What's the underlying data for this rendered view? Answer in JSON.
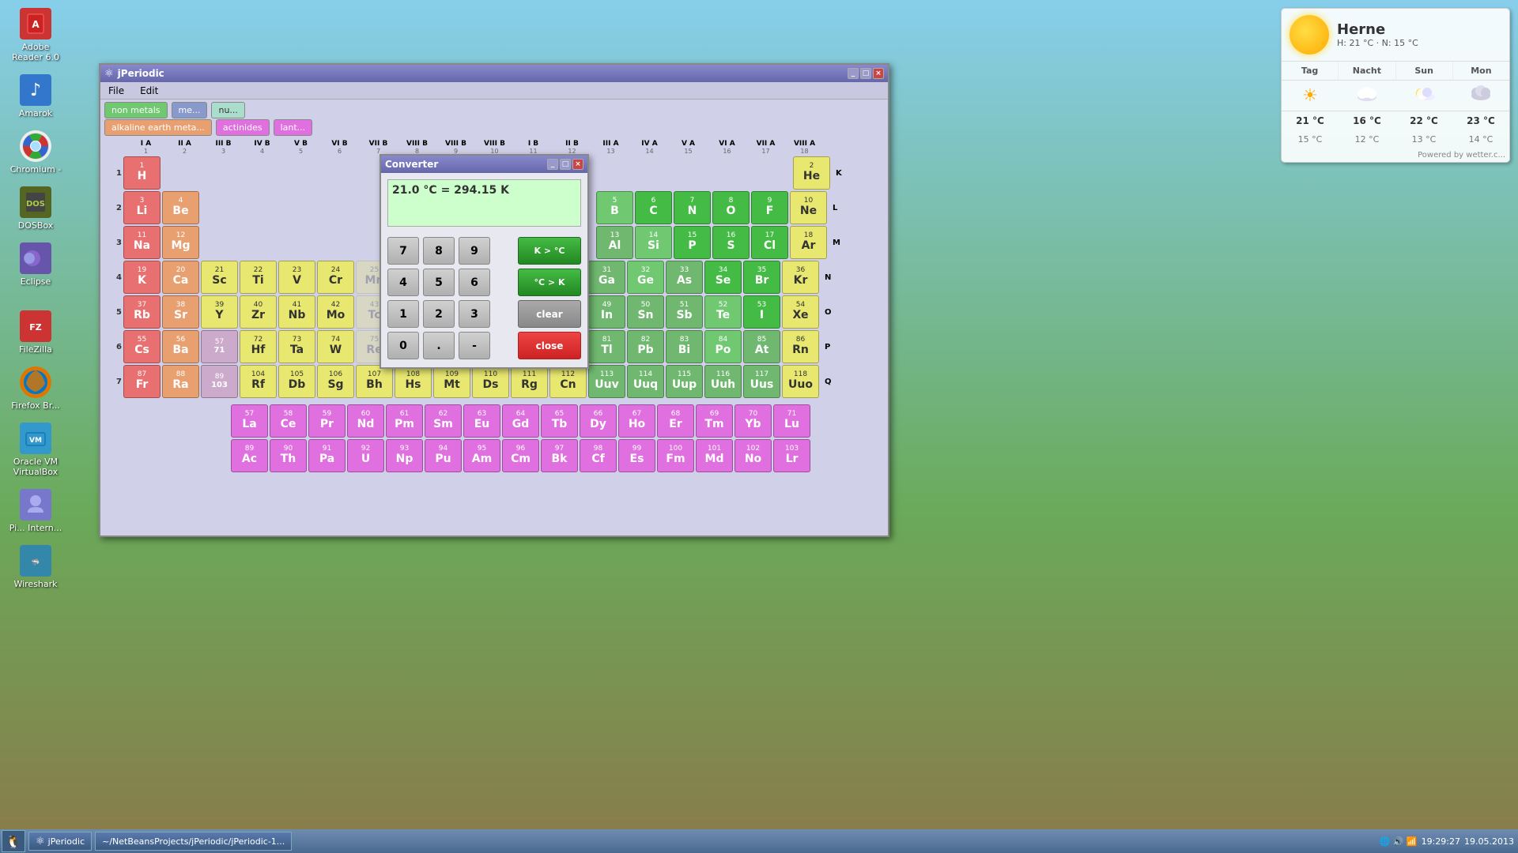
{
  "desktop": {
    "icons": [
      {
        "id": "adobe-reader",
        "label": "Adobe\nReader 6.0",
        "color": "#cc3333",
        "symbol": "A"
      },
      {
        "id": "amarok",
        "label": "Amarok",
        "color": "#3377cc",
        "symbol": "♪"
      },
      {
        "id": "chromium",
        "label": "Chromium-",
        "color": "#4488cc",
        "symbol": "⬤"
      },
      {
        "id": "dosbox",
        "label": "DOSBox",
        "color": "#888833",
        "symbol": "D"
      },
      {
        "id": "eclipse",
        "label": "Eclipse",
        "color": "#5555aa",
        "symbol": "☀"
      },
      {
        "id": "filezilla",
        "label": "FileZilla",
        "color": "#cc3333",
        "symbol": "F"
      },
      {
        "id": "firefox",
        "label": "Firefox\nBr...",
        "color": "#dd7700",
        "symbol": "⬤"
      },
      {
        "id": "oracle-vm",
        "label": "Oracle VM\nVirtualBox",
        "color": "#3399cc",
        "symbol": "V"
      },
      {
        "id": "pidgin",
        "label": "Pi...\nIntern...",
        "color": "#7777cc",
        "symbol": "P"
      },
      {
        "id": "wireshark",
        "label": "Wireshark",
        "color": "#3388aa",
        "symbol": "W"
      }
    ]
  },
  "jperiodic": {
    "title": "jPeriodic",
    "menu": [
      "File",
      "Edit"
    ],
    "tabs": [
      "non metals",
      "me...",
      "nu..."
    ],
    "legend": [
      "non metals",
      "alkaline earth meta...",
      "actinides",
      "lant..."
    ],
    "column_groups": [
      "I A",
      "II A",
      "III B",
      "IV B",
      "V B",
      "VI B",
      "VII B",
      "VIII B",
      "VIII B",
      "VIII B",
      "I B",
      "II B",
      "III A",
      "IV A",
      "V A",
      "VI A",
      "VII A",
      "VIII A"
    ],
    "column_nums": [
      "1",
      "2",
      "3",
      "4",
      "5",
      "6",
      "7",
      "8",
      "9",
      "10",
      "11",
      "12",
      "13",
      "14",
      "15",
      "16",
      "17",
      "18"
    ],
    "row_labels": [
      "K",
      "L",
      "M",
      "N",
      "O",
      "P",
      "Q"
    ],
    "elements": {
      "period1": [
        {
          "num": 1,
          "sym": "H",
          "name": "",
          "class": "alkali",
          "col": 1
        },
        {
          "num": 2,
          "sym": "He",
          "name": "",
          "class": "noble",
          "col": 18
        }
      ],
      "period2": [
        {
          "num": 3,
          "sym": "Li",
          "name": "",
          "class": "alkali",
          "col": 1
        },
        {
          "num": 4,
          "sym": "Be",
          "name": "",
          "class": "alkali-earth",
          "col": 2
        },
        {
          "num": 5,
          "sym": "B",
          "name": "",
          "class": "metalloid",
          "col": 13
        },
        {
          "num": 6,
          "sym": "C",
          "name": "",
          "class": "nonmetal",
          "col": 14
        },
        {
          "num": 7,
          "sym": "N",
          "name": "",
          "class": "nonmetal",
          "col": 15
        },
        {
          "num": 8,
          "sym": "O",
          "name": "",
          "class": "nonmetal",
          "col": 16
        },
        {
          "num": 9,
          "sym": "F",
          "name": "",
          "class": "nonmetal",
          "col": 17
        },
        {
          "num": 10,
          "sym": "Ne",
          "name": "",
          "class": "noble",
          "col": 18
        }
      ],
      "period3": [
        {
          "num": 11,
          "sym": "Na",
          "name": "",
          "class": "alkali",
          "col": 1
        },
        {
          "num": 12,
          "sym": "Mg",
          "name": "",
          "class": "alkali-earth",
          "col": 2
        },
        {
          "num": 13,
          "sym": "Al",
          "name": "",
          "class": "post-transition",
          "col": 13
        },
        {
          "num": 14,
          "sym": "Si",
          "name": "",
          "class": "metalloid",
          "col": 14
        },
        {
          "num": 15,
          "sym": "P",
          "name": "",
          "class": "nonmetal",
          "col": 15
        },
        {
          "num": 16,
          "sym": "S",
          "name": "",
          "class": "nonmetal",
          "col": 16
        },
        {
          "num": 17,
          "sym": "Cl",
          "name": "",
          "class": "nonmetal",
          "col": 17
        },
        {
          "num": 18,
          "sym": "Ar",
          "name": "",
          "class": "noble",
          "col": 18
        }
      ]
    }
  },
  "converter": {
    "title": "Converter",
    "display": "21.0 °C = 294.15 K",
    "buttons": {
      "row1": [
        "7",
        "8",
        "9"
      ],
      "row2": [
        "4",
        "5",
        "6"
      ],
      "row3": [
        "1",
        "2",
        "3"
      ],
      "row4": [
        "0",
        ".",
        "-"
      ],
      "action1": "K > °C",
      "action2": "°C > K",
      "clear": "clear",
      "close": "close"
    }
  },
  "weather": {
    "city": "Herne",
    "subtitle": "H: 21 °C · N: 15 °C",
    "columns": [
      "Tag",
      "Nacht",
      "Sun",
      "Mon"
    ],
    "temps_high": [
      "21 °C",
      "16 °C",
      "22 °C",
      "23 °C"
    ],
    "temps_low": [
      "15 °C",
      "12 °C",
      "13 °C",
      "14 °C"
    ],
    "powered": "Powered by wetter.c...",
    "icons": [
      "☀",
      "🌙",
      "⛅",
      "☁"
    ]
  },
  "taskbar": {
    "start_icon": "🐧",
    "apps": [
      "jPeriodic",
      "~/NetBeansProjects/jPeriodic/jPeriodic-1..."
    ],
    "time": "19:29:27",
    "date": "19.05.2013"
  }
}
